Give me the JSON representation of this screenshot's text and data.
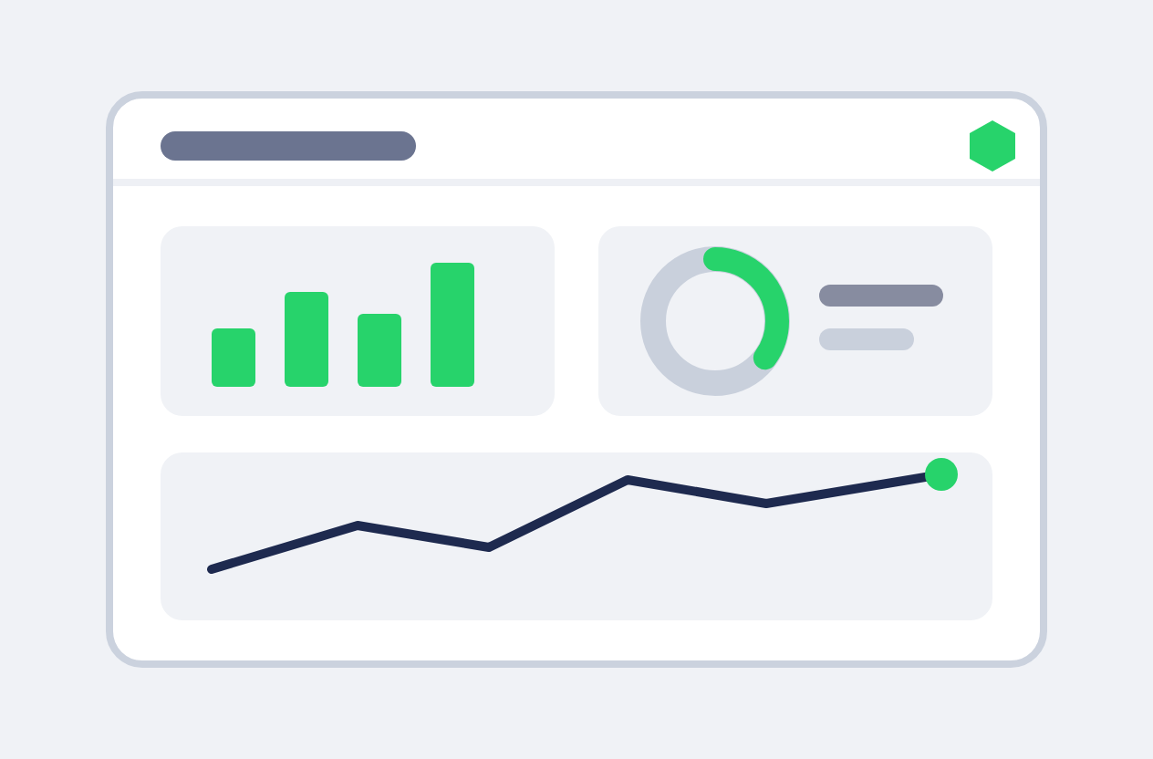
{
  "dashboard": {
    "progress_ring": {
      "level": 0.35
    }
  }
}
